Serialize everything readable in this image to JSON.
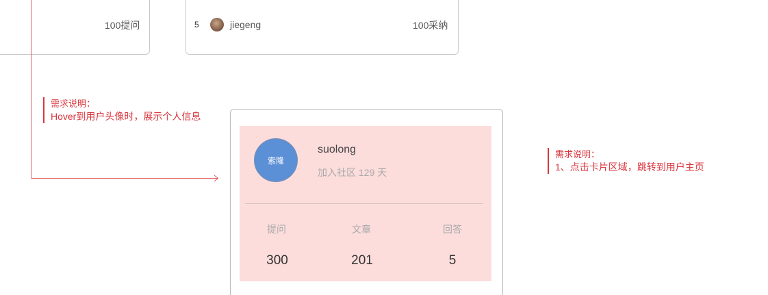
{
  "left_card": {
    "count_text": "100提问"
  },
  "mid_card": {
    "rank": "5",
    "username": "jiegeng",
    "count_text": "100采纳"
  },
  "note_left": {
    "heading": "需求说明：",
    "text": "Hover到用户头像时，展示个人信息"
  },
  "note_right": {
    "heading": "需求说明：",
    "text": "1、点击卡片区域，跳转到用户主页"
  },
  "profile_card": {
    "avatar_text": "索隆",
    "name": "suolong",
    "joined": "加入社区 129 天",
    "stats": [
      {
        "label": "提问",
        "value": "300"
      },
      {
        "label": "文章",
        "value": "201"
      },
      {
        "label": "回答",
        "value": "5"
      }
    ]
  },
  "colors": {
    "annotation": "#d9363e",
    "card_bg": "#fddcdc",
    "avatar_bg": "#5b8fd6"
  }
}
